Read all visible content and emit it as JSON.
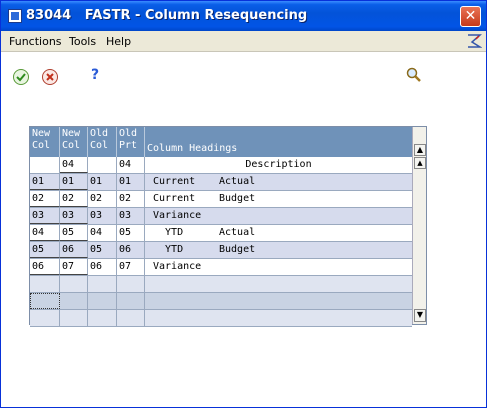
{
  "window": {
    "title": "83044   FASTR - Column Resequencing",
    "close_glyph": "✕"
  },
  "menu": {
    "items": [
      {
        "label": "Functions"
      },
      {
        "label": "Tools"
      },
      {
        "label": "Help"
      }
    ]
  },
  "toolbar": {
    "ok_icon": "check-icon",
    "cancel_icon": "cancel-icon",
    "help_label": "?",
    "search_icon": "magnifier-icon"
  },
  "grid": {
    "headers": {
      "new_col_1": "New\nCol",
      "new_col_2": "New\nCol",
      "old_col": "Old\nCol",
      "old_prt": "Old\nPrt",
      "column_headings": "Column Headings"
    },
    "description_row": {
      "new_col_2": "04",
      "old_prt": "04",
      "heading": "Description"
    },
    "rows": [
      {
        "new_col_1": "01",
        "new_col_2": "01",
        "old_col": "01",
        "old_prt": "01",
        "heading_a": "Current",
        "heading_b": "Actual"
      },
      {
        "new_col_1": "02",
        "new_col_2": "02",
        "old_col": "02",
        "old_prt": "02",
        "heading_a": "Current",
        "heading_b": "Budget"
      },
      {
        "new_col_1": "03",
        "new_col_2": "03",
        "old_col": "03",
        "old_prt": "03",
        "heading_a": "Variance",
        "heading_b": ""
      },
      {
        "new_col_1": "04",
        "new_col_2": "05",
        "old_col": "04",
        "old_prt": "05",
        "heading_a": "  YTD",
        "heading_b": "Actual"
      },
      {
        "new_col_1": "05",
        "new_col_2": "06",
        "old_col": "05",
        "old_prt": "06",
        "heading_a": "  YTD",
        "heading_b": "Budget"
      },
      {
        "new_col_1": "06",
        "new_col_2": "07",
        "old_col": "06",
        "old_prt": "07",
        "heading_a": "Variance",
        "heading_b": ""
      }
    ],
    "scroll_up_glyph": "▲",
    "scroll_top_glyph": "▲",
    "scroll_down_glyph": "▼"
  },
  "colors": {
    "header_bg": "#6f92b9",
    "row_shaded": "#d6dbed",
    "titlebar": "#0353d8"
  }
}
